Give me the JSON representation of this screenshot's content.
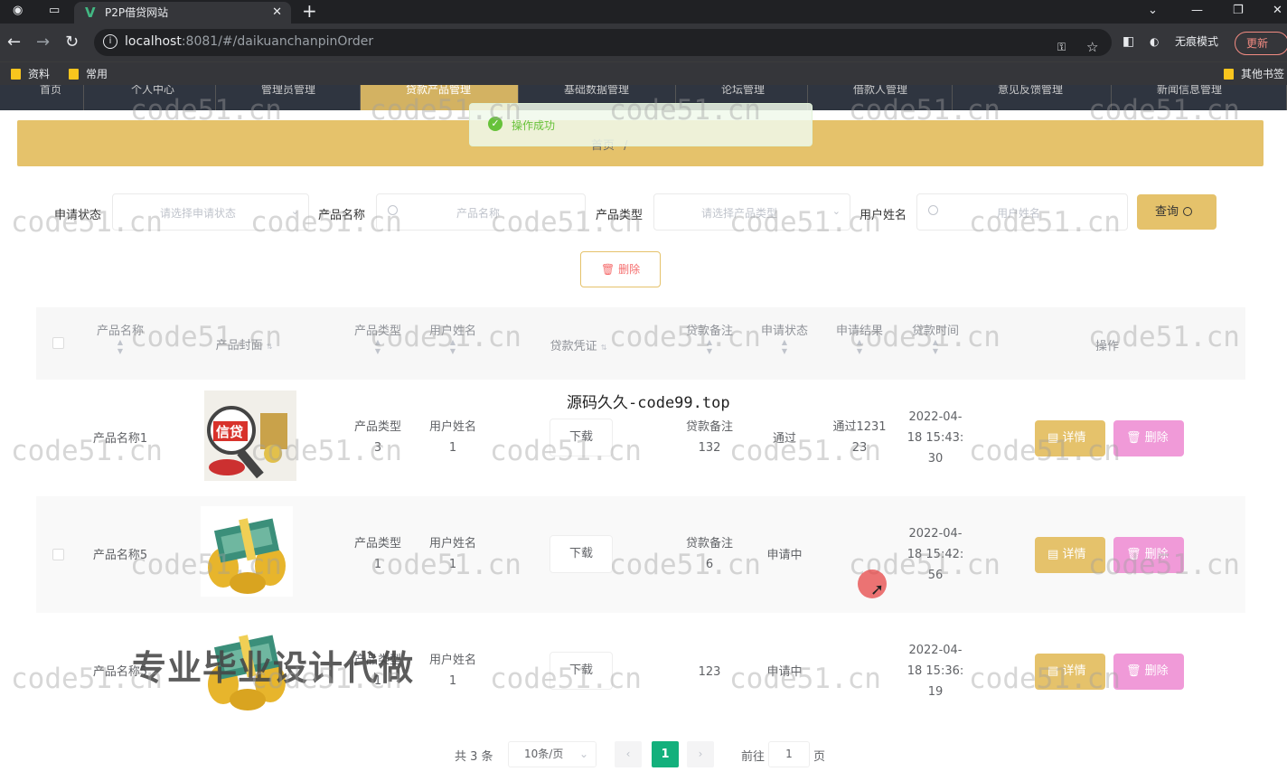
{
  "browser": {
    "tab_title": "P2P借贷网站",
    "url_host": "localhost",
    "url_rest": ":8081/#/daikuanchanpinOrder",
    "incognito_label": "无痕模式",
    "update_label": "更新",
    "bookmarks": [
      "资料",
      "常用"
    ],
    "other_bookmarks": "其他书签"
  },
  "nav": {
    "items": [
      "首页",
      "个人中心",
      "管理员管理",
      "贷款产品管理",
      "基础数据管理",
      "论坛管理",
      "借款人管理",
      "意见反馈管理",
      "新闻信息管理"
    ],
    "active_index": 3
  },
  "toast": {
    "message": "操作成功",
    "color": "#67c23a"
  },
  "breadcrumb": {
    "home": "首页",
    "separator": "/"
  },
  "filters": {
    "status_label": "申请状态",
    "status_placeholder": "请选择申请状态",
    "product_label": "产品名称",
    "product_placeholder": "产品名称",
    "type_label": "产品类型",
    "type_placeholder": "请选择产品类型",
    "user_label": "用户姓名",
    "user_placeholder": "用户姓名",
    "query_label": "查询"
  },
  "actions": {
    "delete_label": "删除"
  },
  "table": {
    "headers": {
      "name": "产品名称",
      "cover": "产品封面",
      "type": "产品类型",
      "user": "用户姓名",
      "voucher": "贷款凭证",
      "remark": "贷款备注",
      "status": "申请状态",
      "result": "申请结果",
      "time": "贷款时间",
      "ops": "操作"
    },
    "rows": [
      {
        "name": "产品名称1",
        "type_l1": "产品类型",
        "type_l2": "3",
        "user_l1": "用户姓名",
        "user_l2": "1",
        "voucher": "下载",
        "remark_l1": "贷款备注",
        "remark_l2": "132",
        "status": "通过",
        "result_l1": "通过1231",
        "result_l2": "23",
        "time_l1": "2022-04-",
        "time_l2": "18 15:43:",
        "time_l3": "30",
        "detail": "详情",
        "del": "删除",
        "cover": "loan-sign-image"
      },
      {
        "name": "产品名称5",
        "type_l1": "产品类型",
        "type_l2": "1",
        "user_l1": "用户姓名",
        "user_l2": "1",
        "voucher": "下载",
        "remark_l1": "贷款备注",
        "remark_l2": "6",
        "status": "申请中",
        "result_l1": "",
        "result_l2": "",
        "time_l1": "2022-04-",
        "time_l2": "18 15:42:",
        "time_l3": "56",
        "detail": "详情",
        "del": "删除",
        "cover": "money-coins-image"
      },
      {
        "name": "产品名称5",
        "type_l1": "产品类型",
        "type_l2": "1",
        "user_l1": "用户姓名",
        "user_l2": "1",
        "voucher": "下载",
        "remark_l1": "123",
        "remark_l2": "",
        "status": "申请中",
        "result_l1": "",
        "result_l2": "",
        "time_l1": "2022-04-",
        "time_l2": "18 15:36:",
        "time_l3": "19",
        "detail": "详情",
        "del": "删除",
        "cover": "money-coins-image"
      }
    ]
  },
  "pagination": {
    "total": "共 3 条",
    "page_size": "10条/页",
    "current": "1",
    "goto_label": "前往",
    "goto_value": "1",
    "page_suffix": "页"
  },
  "overlays": {
    "top_text": "源码久久-code99.top",
    "big_text": "专业毕业设计代做",
    "watermark": "code51.cn"
  },
  "colors": {
    "accent": "#e5c26b",
    "delete_pink": "#f09ad8",
    "pager_active": "#13b07c",
    "nav_dark": "#2f3540"
  }
}
